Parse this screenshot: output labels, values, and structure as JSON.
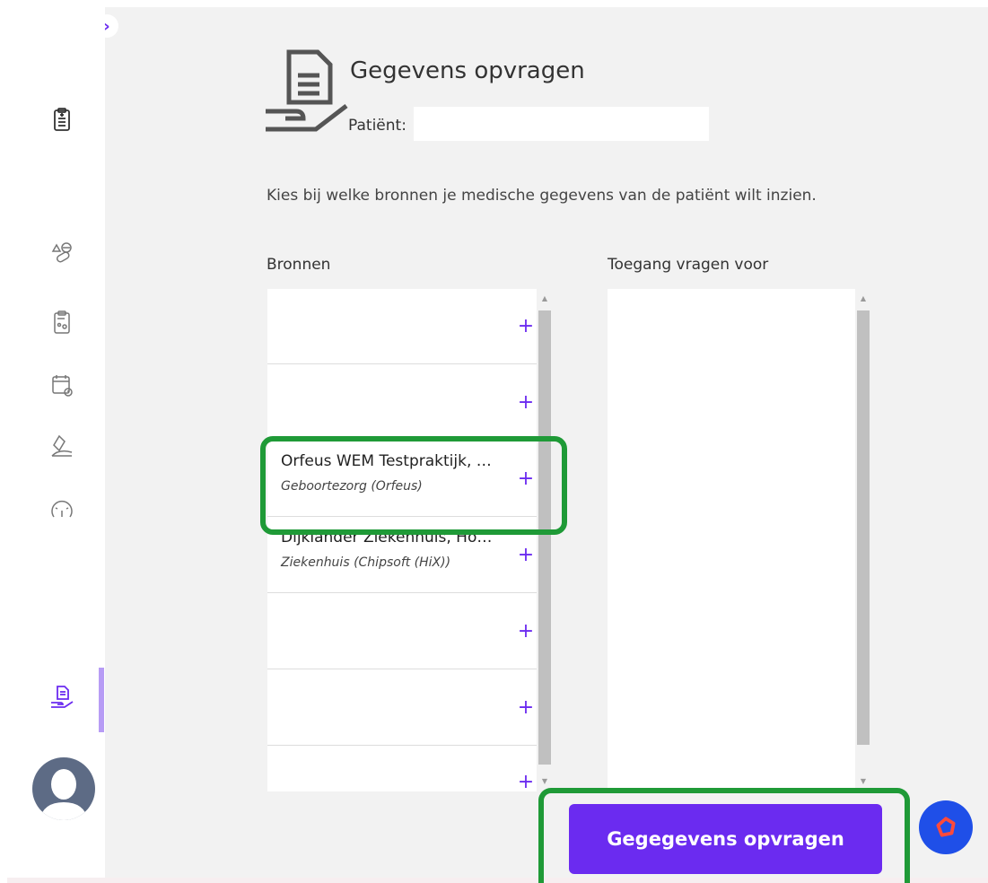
{
  "page": {
    "title": "Gegevens opvragen",
    "patient_label": "Patiënt:",
    "patient_value": "",
    "instructions": "Kies bij welke bronnen je medische gegevens van de patiënt wilt inzien."
  },
  "sources_column": {
    "header": "Bronnen",
    "rows": [
      {
        "name": "",
        "type": ""
      },
      {
        "name": "",
        "type": ""
      },
      {
        "name": "Orfeus WEM Testpraktijk, …",
        "type": "Geboortezorg (Orfeus)"
      },
      {
        "name": "Dijklander Ziekenhuis, Ho…",
        "type": "Ziekenhuis (Chipsoft (HiX))"
      },
      {
        "name": "",
        "type": ""
      },
      {
        "name": "",
        "type": ""
      },
      {
        "name": "",
        "type": ""
      }
    ],
    "add_symbol": "+"
  },
  "access_column": {
    "header": "Toegang vragen voor"
  },
  "actions": {
    "submit_label": "Gegegevens opvragen"
  },
  "sidebar": {
    "expand_symbol": "›",
    "items": [
      "clipboard-icon",
      "medication-icon",
      "patient-record-icon",
      "calendar-icon",
      "lab-icon",
      "gauge-icon",
      "data-request-icon"
    ]
  },
  "colors": {
    "accent": "#6b2bf0",
    "highlight": "#1f9a37",
    "help_button": "#1f4fe8",
    "background": "#f2f2f2"
  }
}
